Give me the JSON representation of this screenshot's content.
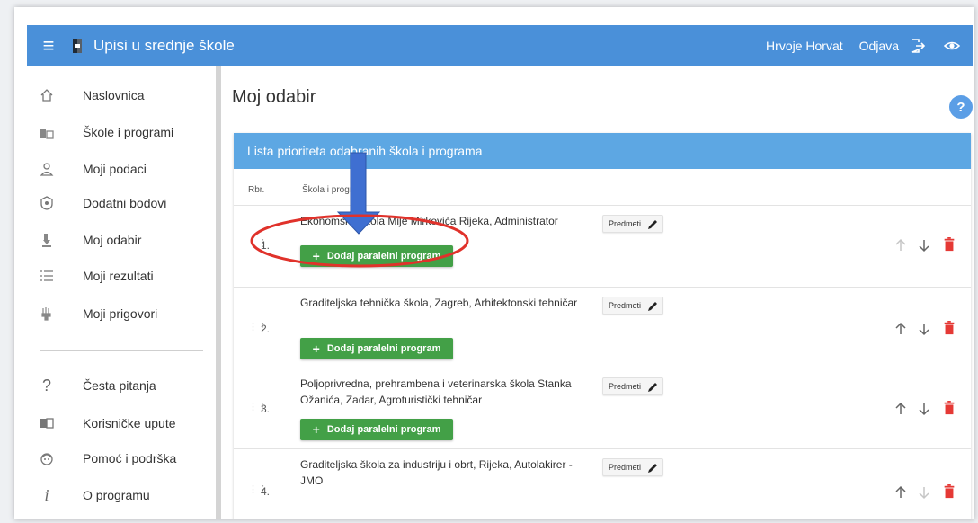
{
  "topbar": {
    "app_title": "Upisi u srednje škole",
    "user_name": "Hrvoje Horvat",
    "logout_label": "Odjava"
  },
  "sidebar": {
    "items": [
      {
        "label": "Naslovnica",
        "icon": "home-icon"
      },
      {
        "label": "Škole i programi",
        "icon": "school-icon"
      },
      {
        "label": "Moji podaci",
        "icon": "person-icon"
      },
      {
        "label": "Dodatni bodovi",
        "icon": "badge-icon"
      },
      {
        "label": "Moj odabir",
        "icon": "choice-icon"
      },
      {
        "label": "Moji rezultati",
        "icon": "list-icon"
      },
      {
        "label": "Moji prigovori",
        "icon": "complaint-icon"
      }
    ],
    "secondary": [
      {
        "label": "Česta pitanja",
        "icon": "question-icon"
      },
      {
        "label": "Korisničke upute",
        "icon": "book-icon"
      },
      {
        "label": "Pomoć i podrška",
        "icon": "support-icon"
      },
      {
        "label": "O programu",
        "icon": "info-icon"
      }
    ]
  },
  "main": {
    "title": "Moj odabir",
    "help": "?",
    "card_title": "Lista prioriteta odabranih škola i programa",
    "columns": {
      "rbr": "Rbr.",
      "skola": "Škola i program"
    },
    "predmeti_label": "Predmeti",
    "add_label": "Dodaj paralelni program",
    "rows": [
      {
        "num": "1.",
        "name": "Ekonomska škola Mije Mirkovića Rijeka, Administrator"
      },
      {
        "num": "2.",
        "name": "Graditeljska tehnička škola, Zagreb, Arhitektonski tehničar"
      },
      {
        "num": "3.",
        "name": "Poljoprivredna, prehrambena i veterinarska škola Stanka Ožanića, Zadar, Agroturistički tehničar"
      },
      {
        "num": "4.",
        "name": "Graditeljska škola za industriju i obrt, Rijeka, Autolakirer - JMO"
      }
    ]
  },
  "colors": {
    "topbar": "#4a90d9",
    "card_header": "#5da7e3",
    "add_button": "#43a047",
    "delete": "#e53935",
    "annotation_arrow": "#3f6fd1",
    "annotation_ellipse": "#e0322b"
  }
}
